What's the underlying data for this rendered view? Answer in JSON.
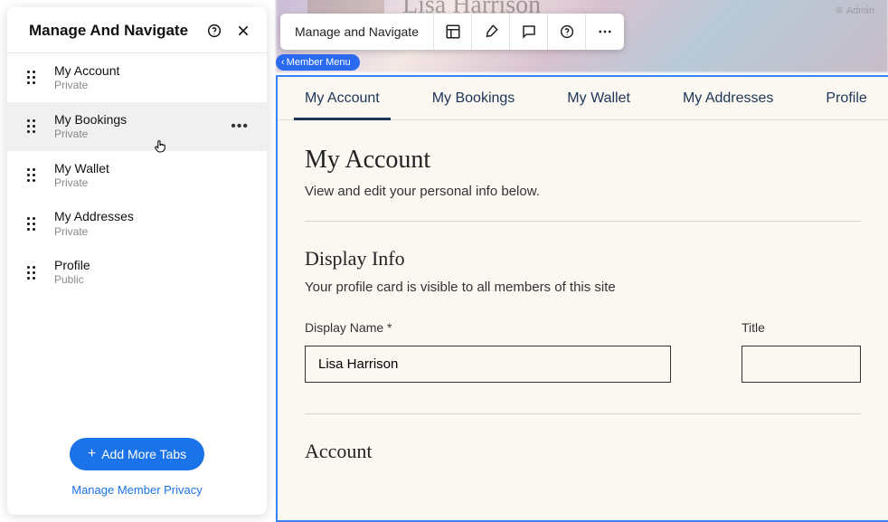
{
  "panel": {
    "title": "Manage And Navigate",
    "items": [
      {
        "label": "My Account",
        "privacy": "Private",
        "hovered": false,
        "showMore": false
      },
      {
        "label": "My Bookings",
        "privacy": "Private",
        "hovered": true,
        "showMore": true
      },
      {
        "label": "My Wallet",
        "privacy": "Private",
        "hovered": false,
        "showMore": false
      },
      {
        "label": "My Addresses",
        "privacy": "Private",
        "hovered": false,
        "showMore": false
      },
      {
        "label": "Profile",
        "privacy": "Public",
        "hovered": false,
        "showMore": false
      }
    ],
    "add_button": "Add More Tabs",
    "privacy_link": "Manage Member Privacy"
  },
  "toolbar": {
    "label": "Manage and Navigate"
  },
  "member_chip": "Member Menu",
  "header": {
    "name_bg": "Lisa Harrison",
    "admin_label": "Admin"
  },
  "tabs": [
    {
      "label": "My Account",
      "active": true
    },
    {
      "label": "My Bookings",
      "active": false
    },
    {
      "label": "My Wallet",
      "active": false
    },
    {
      "label": "My Addresses",
      "active": false
    },
    {
      "label": "Profile",
      "active": false
    }
  ],
  "account": {
    "title": "My Account",
    "subtitle": "View and edit your personal info below.",
    "display_info_title": "Display Info",
    "display_info_sub": "Your profile card is visible to all members of this site",
    "display_name_label": "Display Name *",
    "display_name_value": "Lisa Harrison",
    "title_label": "Title",
    "title_value": "",
    "account_section": "Account"
  }
}
